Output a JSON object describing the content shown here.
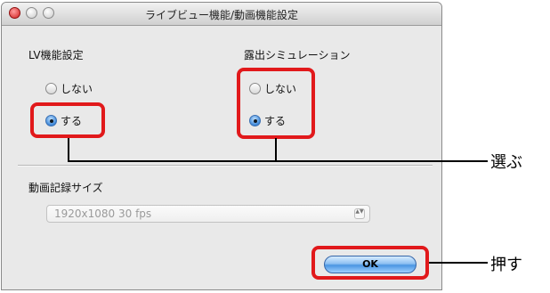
{
  "window": {
    "title": "ライブビュー機能/動画機能設定"
  },
  "lv_settings": {
    "heading": "LV機能設定",
    "options": [
      {
        "label": "しない",
        "selected": false
      },
      {
        "label": "する",
        "selected": true
      }
    ]
  },
  "exposure_simulation": {
    "heading": "露出シミュレーション",
    "options": [
      {
        "label": "しない",
        "selected": false
      },
      {
        "label": "する",
        "selected": true
      }
    ]
  },
  "movie_size": {
    "heading": "動画記録サイズ",
    "selected_value": "1920x1080 30 fps",
    "arrow_glyphs": "▲▼"
  },
  "buttons": {
    "ok_label": "OK"
  },
  "annotations": {
    "select_label": "選ぶ",
    "press_label": "押す",
    "highlight_color": "#e1191b"
  }
}
